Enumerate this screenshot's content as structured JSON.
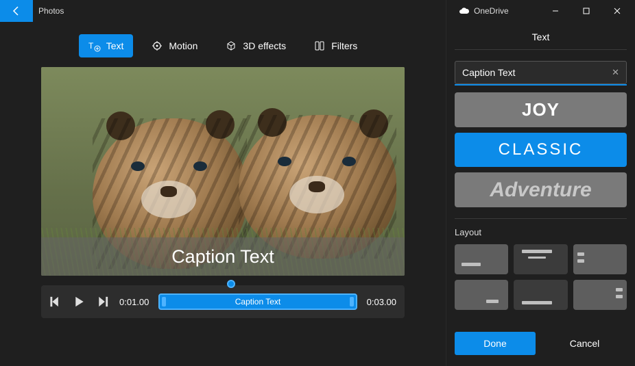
{
  "app": {
    "title": "Photos"
  },
  "cloud": {
    "label": "OneDrive"
  },
  "toolbar": {
    "text": "Text",
    "motion": "Motion",
    "effects": "3D effects",
    "filters": "Filters"
  },
  "preview": {
    "caption": "Caption Text"
  },
  "timeline": {
    "current": "0:01.00",
    "end": "0:03.00",
    "clip_label": "Caption Text"
  },
  "panel": {
    "title": "Text",
    "input_value": "Caption Text",
    "clear_glyph": "✕",
    "styles": {
      "joy": "JOY",
      "classic": "CLASSIC",
      "adventure": "Adventure"
    },
    "layout_label": "Layout",
    "done": "Done",
    "cancel": "Cancel"
  }
}
